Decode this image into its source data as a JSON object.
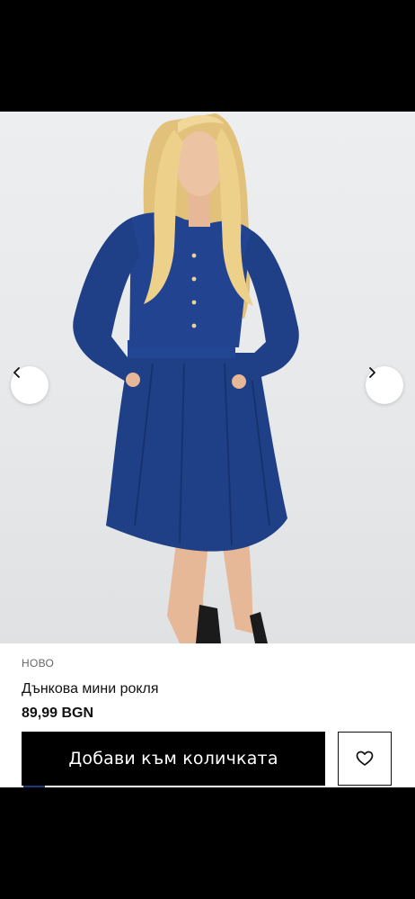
{
  "product": {
    "badge": "НОВО",
    "title": "Дънкова мини рокля",
    "price": "89,99 BGN"
  },
  "gallery": {
    "prev_icon": "chevron-left-icon",
    "next_icon": "chevron-right-icon"
  },
  "actions": {
    "add_to_cart_label": "Добави към количката",
    "wishlist_icon": "heart-icon"
  },
  "colors": {
    "denim": "#1f3f86",
    "button_bg": "#000000",
    "button_text": "#ffffff"
  }
}
